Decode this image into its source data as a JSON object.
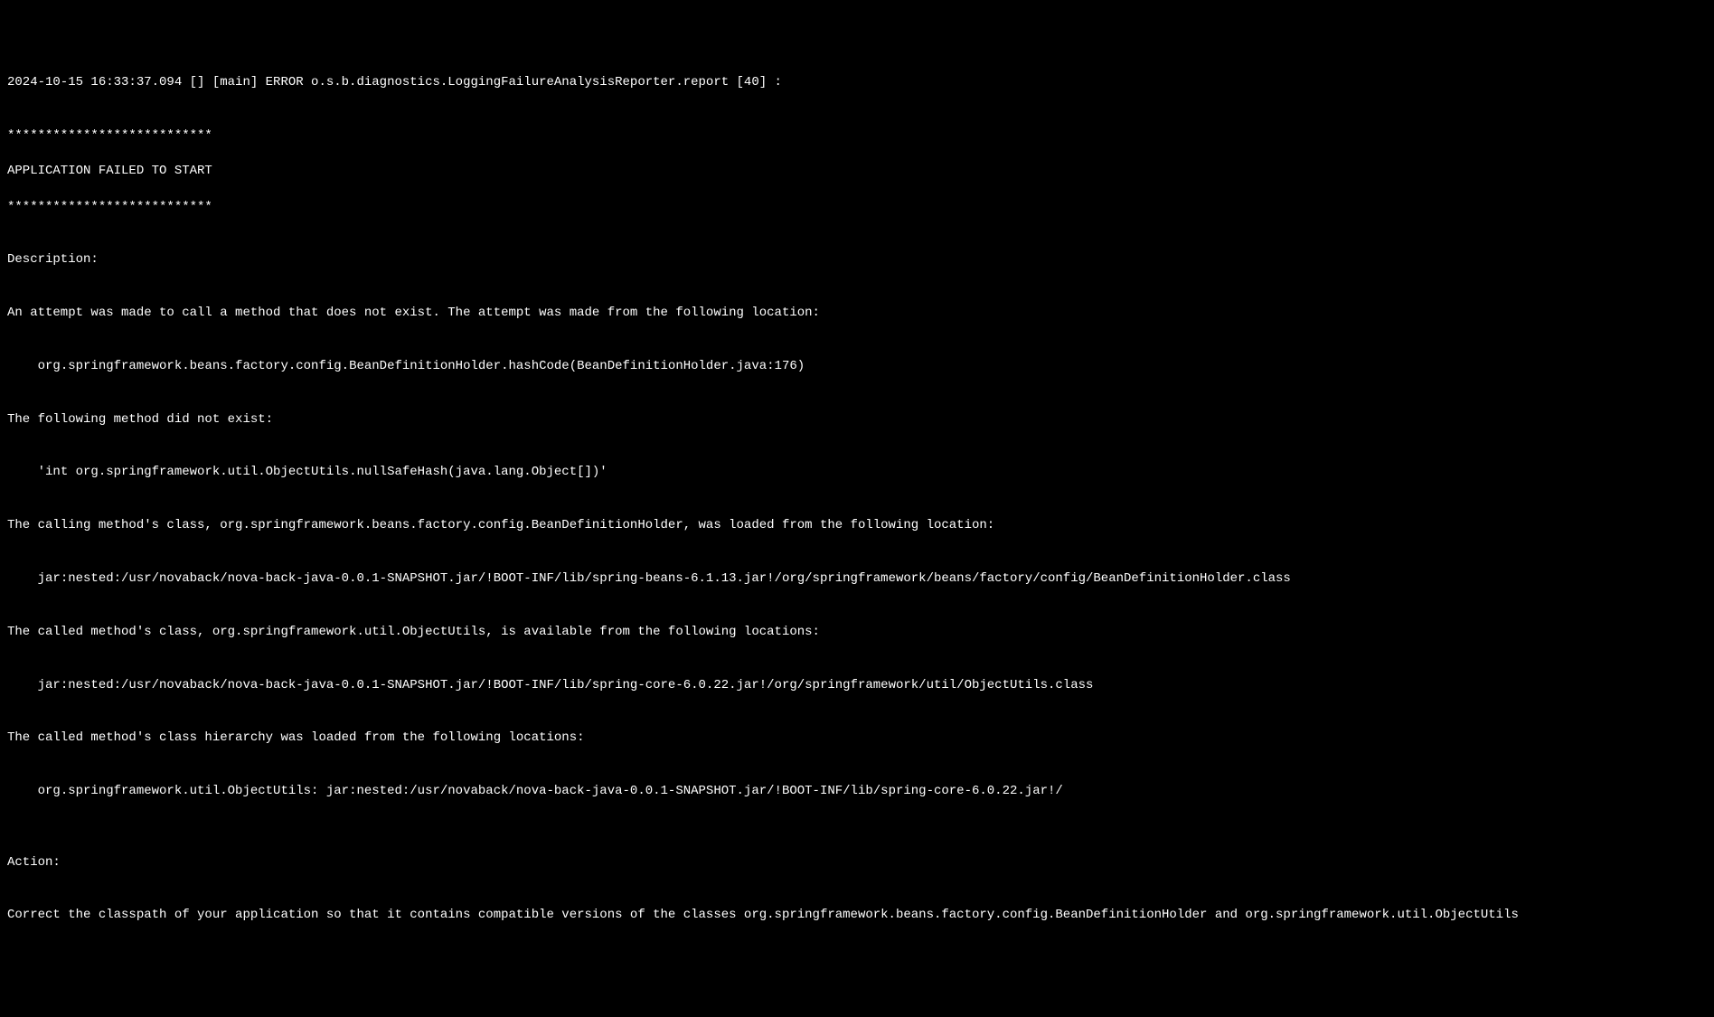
{
  "log": {
    "header": "2024-10-15 16:33:37.094 [] [main] ERROR o.s.b.diagnostics.LoggingFailureAnalysisReporter.report [40] :",
    "separator_top": "\n***************************",
    "title": "APPLICATION FAILED TO START",
    "separator_bottom": "***************************",
    "description_label": "\nDescription:",
    "description_intro": "\nAn attempt was made to call a method that does not exist. The attempt was made from the following location:",
    "calling_location": "\n    org.springframework.beans.factory.config.BeanDefinitionHolder.hashCode(BeanDefinitionHolder.java:176)",
    "method_not_exist_label": "\nThe following method did not exist:",
    "method_not_exist": "\n    'int org.springframework.util.ObjectUtils.nullSafeHash(java.lang.Object[])'",
    "calling_class_label": "\nThe calling method's class, org.springframework.beans.factory.config.BeanDefinitionHolder, was loaded from the following location:",
    "calling_class_location": "\n    jar:nested:/usr/novaback/nova-back-java-0.0.1-SNAPSHOT.jar/!BOOT-INF/lib/spring-beans-6.1.13.jar!/org/springframework/beans/factory/config/BeanDefinitionHolder.class",
    "called_class_label": "\nThe called method's class, org.springframework.util.ObjectUtils, is available from the following locations:",
    "called_class_location": "\n    jar:nested:/usr/novaback/nova-back-java-0.0.1-SNAPSHOT.jar/!BOOT-INF/lib/spring-core-6.0.22.jar!/org/springframework/util/ObjectUtils.class",
    "hierarchy_label": "\nThe called method's class hierarchy was loaded from the following locations:",
    "hierarchy_location": "\n    org.springframework.util.ObjectUtils: jar:nested:/usr/novaback/nova-back-java-0.0.1-SNAPSHOT.jar/!BOOT-INF/lib/spring-core-6.0.22.jar!/",
    "action_label": "\n\nAction:",
    "action_text": "\nCorrect the classpath of your application so that it contains compatible versions of the classes org.springframework.beans.factory.config.BeanDefinitionHolder and org.springframework.util.ObjectUtils"
  }
}
